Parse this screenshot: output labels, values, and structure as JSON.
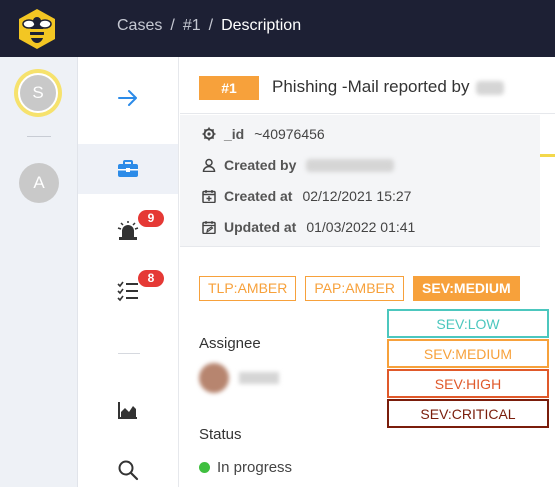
{
  "breadcrumb": {
    "items": [
      "Cases",
      "#1",
      "Description"
    ],
    "separator": "/"
  },
  "rail": {
    "user_initial": "S",
    "org_initial": "A"
  },
  "nav": {
    "alerts_count": "9",
    "tasks_count": "8"
  },
  "case": {
    "number": "#1",
    "title": "Phishing -Mail reported by",
    "id_label": "_id",
    "id_value": "~40976456",
    "created_by_label": "Created by",
    "created_at_label": "Created at",
    "created_at_value": "02/12/2021 15:27",
    "updated_at_label": "Updated at",
    "updated_at_value": "01/03/2022 01:41"
  },
  "tags": {
    "tlp": "TLP:AMBER",
    "pap": "PAP:AMBER",
    "sev": "SEV:MEDIUM"
  },
  "assignee": {
    "label": "Assignee"
  },
  "status": {
    "label": "Status",
    "value": "In progress"
  },
  "severity_options": [
    "SEV:LOW",
    "SEV:MEDIUM",
    "SEV:HIGH",
    "SEV:CRITICAL"
  ],
  "colors": {
    "topbar": "#1d2034",
    "amber": "#f7a13b",
    "sev_low": "#4cc7be",
    "sev_medium": "#f7a13b",
    "sev_high": "#e0592a",
    "sev_critical": "#7a1d0b",
    "badge": "#e53935",
    "status_green": "#3fbf3f"
  },
  "icons": [
    "bee-logo-icon",
    "arrow-right-icon",
    "briefcase-icon",
    "siren-icon",
    "checklist-icon",
    "chart-icon",
    "search-icon",
    "gear-icon",
    "user-icon",
    "calendar-plus-icon",
    "calendar-edit-icon"
  ]
}
